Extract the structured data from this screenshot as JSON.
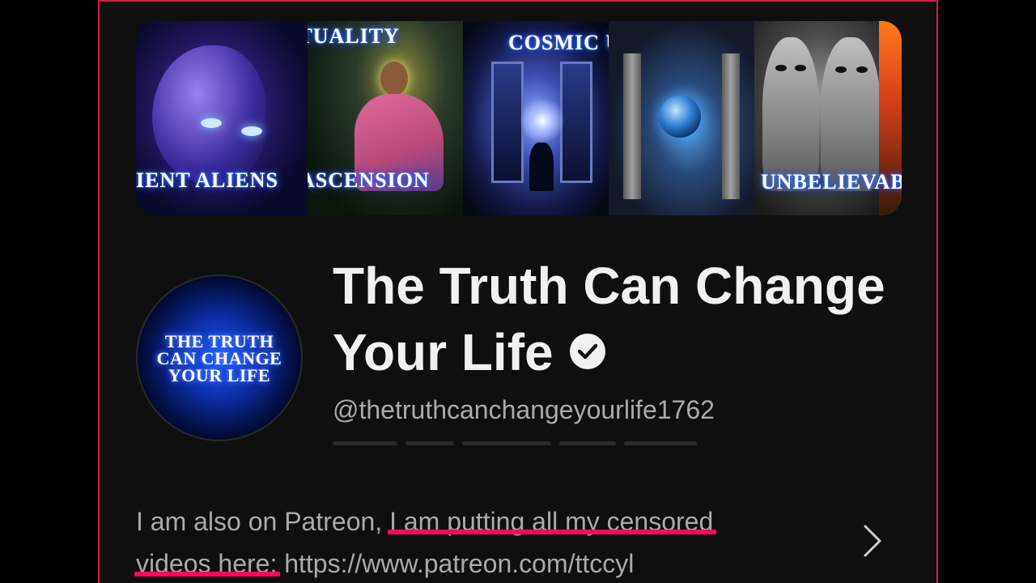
{
  "banner": {
    "captions": {
      "aliens": "IENT ALIENS",
      "spirituality": "SPIRITUALITY",
      "ascension": "ASCENSION",
      "cosmic": "COSMIC UPDATE",
      "unbelievable": "UNBELIEVAB"
    }
  },
  "avatar": {
    "line1": "THE TRUTH",
    "line2": "CAN CHANGE",
    "line3": "YOUR LIFE"
  },
  "channel": {
    "title_line1": "The Truth Can Change",
    "title_line2": "Your Life",
    "handle": "@thetruthcanchangeyourlife1762",
    "verified_icon": "verified-check-icon"
  },
  "description": {
    "part1": "I am also on Patreon, ",
    "highlight1": "I am putting all my censored",
    "highlight2": "videos here:",
    "part2": " https://www.patreon.com/ttccyl"
  },
  "colors": {
    "background": "#0f0f0f",
    "frame_border": "#d61a4b",
    "underline": "#ff0a58",
    "title": "#f1f1f1",
    "secondary_text": "#aaaaaa"
  }
}
